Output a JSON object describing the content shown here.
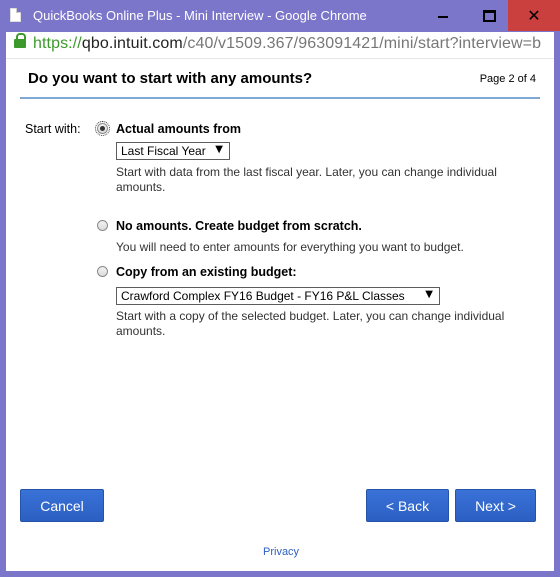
{
  "window": {
    "title": "QuickBooks Online Plus - Mini Interview - Google Chrome",
    "controls": {
      "minimize": "minimize",
      "maximize": "maximize",
      "close": "✕"
    }
  },
  "address": {
    "scheme": "https://",
    "host": "qbo.intuit.com",
    "path": "/c40/v1509.367/963091421/mini/start?interview=b"
  },
  "header": {
    "question": "Do you want to start with any amounts?",
    "page": "Page 2 of 4"
  },
  "form": {
    "start_with_label": "Start with:",
    "options": [
      {
        "title": "Actual amounts from",
        "checked": true,
        "select_value": "Last Fiscal Year",
        "description": "Start with data from the last fiscal year. Later, you can change individual amounts."
      },
      {
        "title": "No amounts. Create budget from scratch.",
        "checked": false,
        "description": "You will need to enter amounts for everything you want to budget."
      },
      {
        "title": "Copy from an existing budget:",
        "checked": false,
        "select_value": "Crawford Complex FY16 Budget - FY16 P&L Classes",
        "description": "Start with a copy of the selected budget. Later, you can change individual amounts."
      }
    ],
    "select_arrow": "▼"
  },
  "buttons": {
    "cancel": "Cancel",
    "back": "< Back",
    "next": "Next >"
  },
  "footer": {
    "privacy": "Privacy"
  },
  "colors": {
    "titlebar": "#7c76cb",
    "close_button": "#c9403f",
    "button_blue": "#2c5fc2",
    "header_rule": "#7fa9d4",
    "secure_green": "#3c9a2c"
  }
}
